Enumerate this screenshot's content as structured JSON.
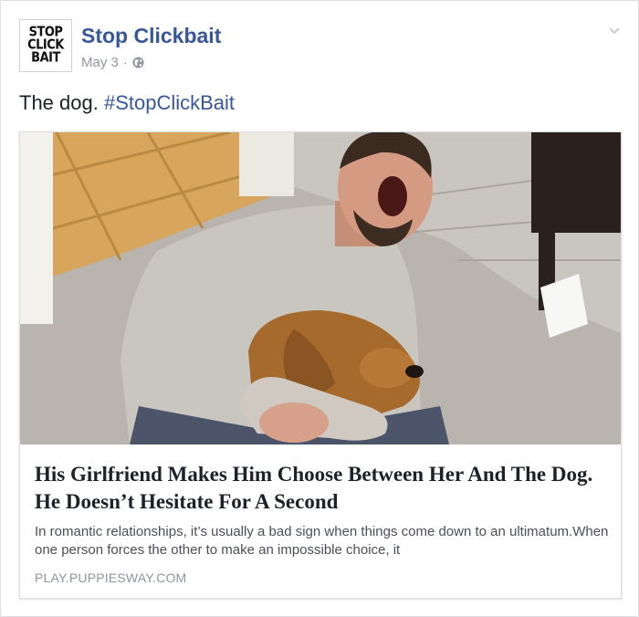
{
  "post": {
    "avatar": {
      "lines": [
        "STOP",
        "CLICK",
        "BAIT"
      ]
    },
    "page_name": "Stop Clickbait",
    "date": "May 3",
    "separator": "·",
    "status_text": "The dog.",
    "hashtag": "#StopClickBait",
    "icons": {
      "audience": "globe-icon",
      "options": "chevron-down-icon"
    }
  },
  "link": {
    "image_alt": "Man crying while hugging a golden dog",
    "title": "His Girlfriend Makes Him Choose Between Her And The Dog. He Doesn’t Hesitate For A Second",
    "description": "In romantic relationships, it’s usually a bad sign when things come down to an ultimatum.When one person forces the other to make an impossible choice, it",
    "domain": "PLAY.PUPPIESWAY.COM"
  },
  "colors": {
    "link_blue": "#365899",
    "meta_gray": "#90949c",
    "text": "#1d2129"
  }
}
